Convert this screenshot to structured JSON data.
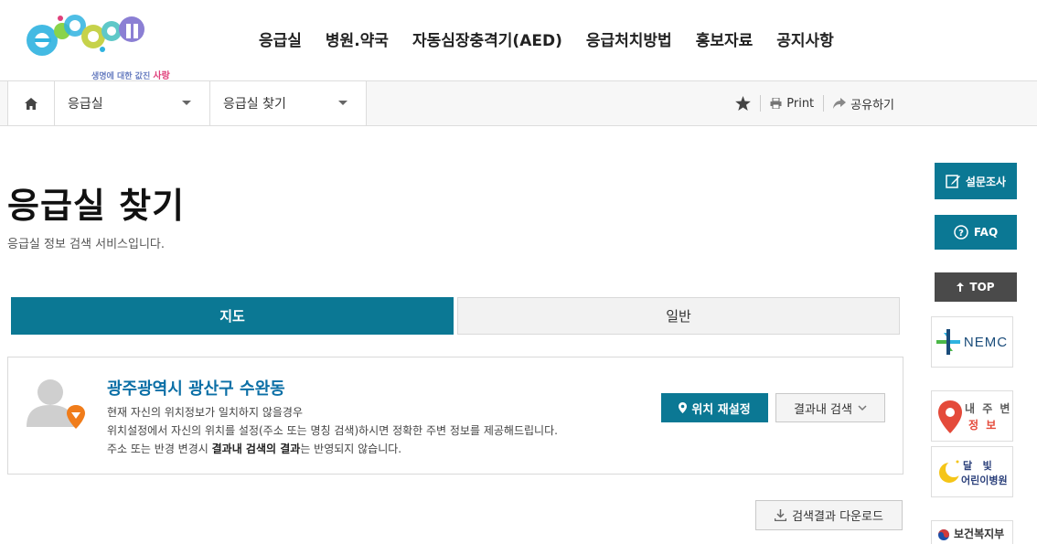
{
  "logo": {
    "text": "e-gen",
    "tagline_pre": "생명에 대한 값진",
    "tagline_em": "사랑"
  },
  "nav": [
    "응급실",
    "병원.약국",
    "자동심장충격기(AED)",
    "응급처치방법",
    "홍보자료",
    "공지사항"
  ],
  "location": {
    "depth1": "응급실",
    "depth2": "응급실 찾기",
    "print_label": "Print",
    "share_label": "공유하기"
  },
  "page": {
    "title": "응급실 찾기",
    "description": "응급실 정보 검색 서비스입니다."
  },
  "tabs": [
    {
      "label": "지도",
      "active": true
    },
    {
      "label": "일반",
      "active": false
    }
  ],
  "current_location": {
    "name": "광주광역시 광산구 수완동",
    "line1": "현재 자신의 위치정보가 일치하지 않을경우",
    "line2": "위치설정에서 자신의 위치를 설정(주소 또는 명칭 검색)하시면 정확한 주변 정보를 제공해드립니다.",
    "line3_pre": "주소 또는 반경 변경시 ",
    "line3_bold": "결과내 검색의 결과",
    "line3_post": "는 반영되지 않습니다.",
    "reset_label": "위치 재설정",
    "insearch_label": "결과내 검색"
  },
  "download_label": "검색결과 다운로드",
  "quick_menu": {
    "survey": "설문조사",
    "faq": "FAQ",
    "top": "TOP",
    "nemc": "NEMC",
    "near_a": "내 주 변",
    "near_b": "정 보",
    "moon_a": "달   빛",
    "moon_b": "어린이병원",
    "mohw": "보건복지부"
  },
  "colors": {
    "primary": "#0b7894",
    "link": "#0b6fa6",
    "pin": "#f07c1a"
  }
}
